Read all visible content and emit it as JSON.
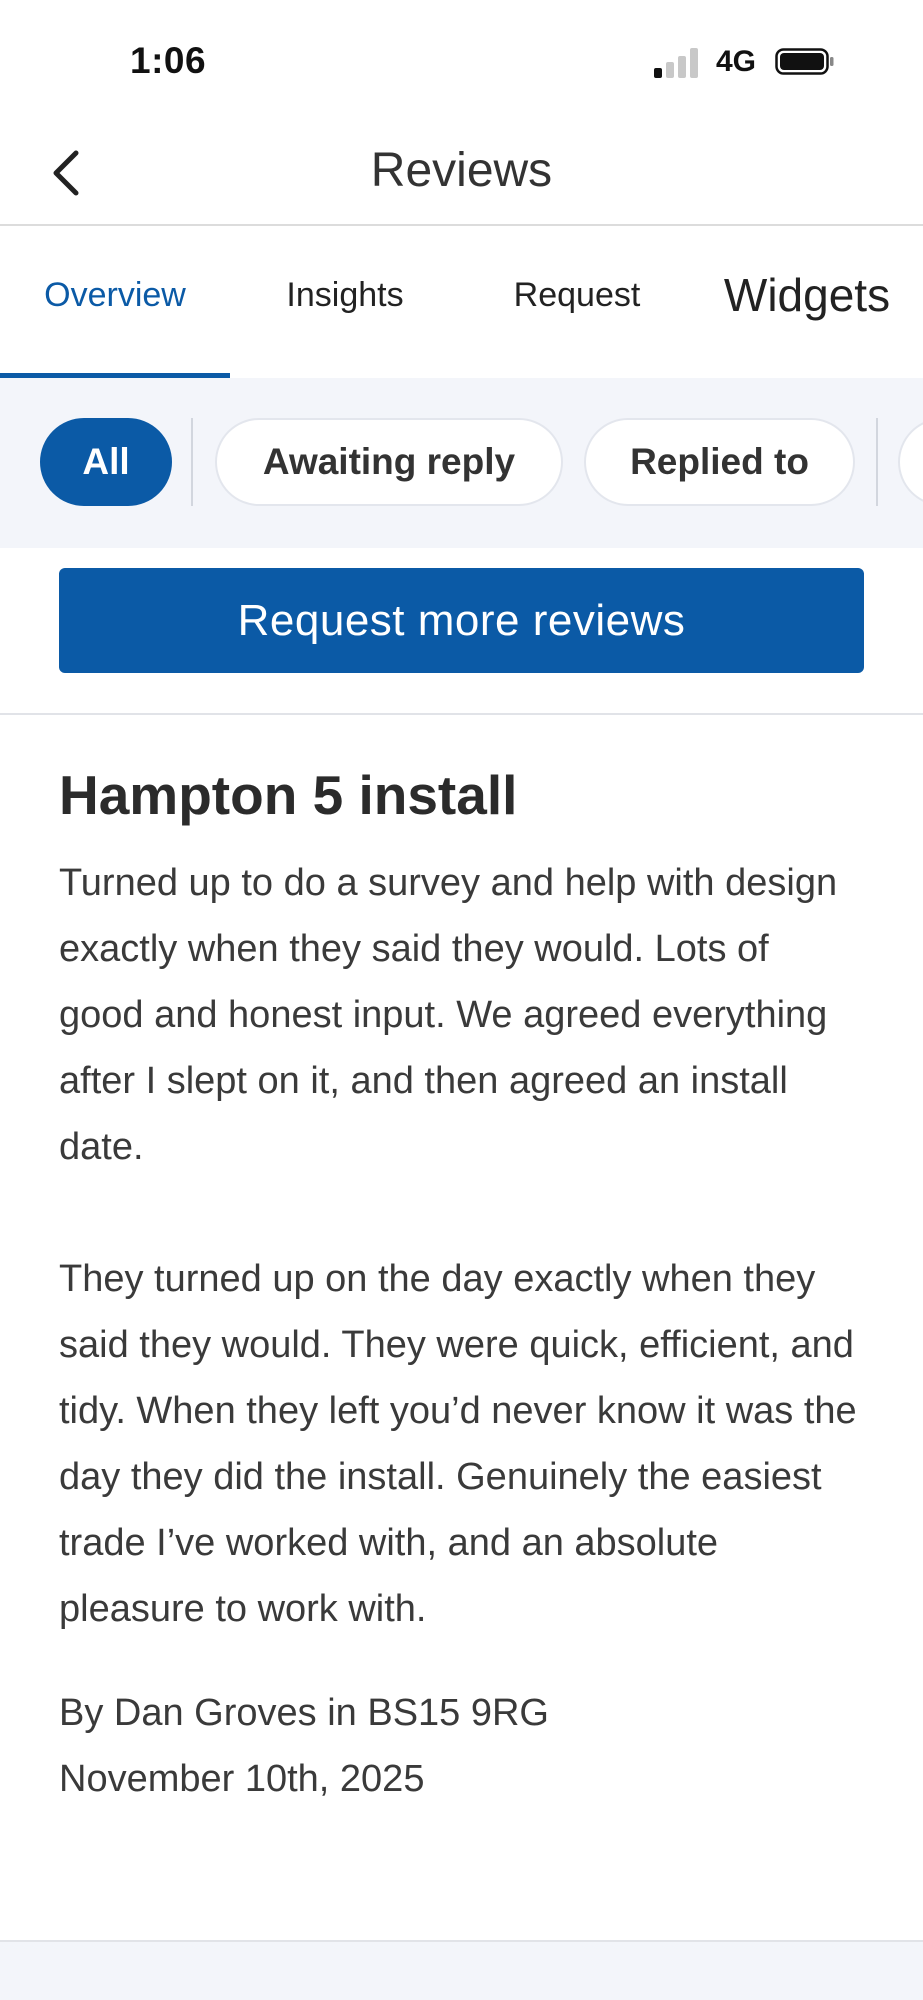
{
  "status_bar": {
    "time": "1:06",
    "network": "4G"
  },
  "header": {
    "title": "Reviews"
  },
  "tabs": [
    {
      "label": "Overview",
      "active": true
    },
    {
      "label": "Insights",
      "active": false
    },
    {
      "label": "Request",
      "active": false
    },
    {
      "label": "Widgets",
      "active": false
    }
  ],
  "filters": [
    {
      "label": "All",
      "active": true
    },
    {
      "label": "Awaiting reply",
      "active": false
    },
    {
      "label": "Replied to",
      "active": false
    }
  ],
  "request_button": {
    "label": "Request more reviews"
  },
  "review": {
    "title": "Hampton 5 install",
    "body": "Turned up to do a survey and help with design exactly when they said they would. Lots of good and honest input. We agreed everything after I slept on it, and then agreed an install date.\n\nThey turned up on the day exactly when they said they would. They were quick, efficient, and tidy. When they left you’d never know it was the day they did the install. Genuinely the easiest trade I’ve worked with, and an absolute pleasure to work with.",
    "author_line": "By Dan Groves in BS15 9RG",
    "date": "November 10th, 2025"
  },
  "colors": {
    "accent": "#0b5aa6",
    "chip_bar_bg": "#f3f5fa"
  }
}
